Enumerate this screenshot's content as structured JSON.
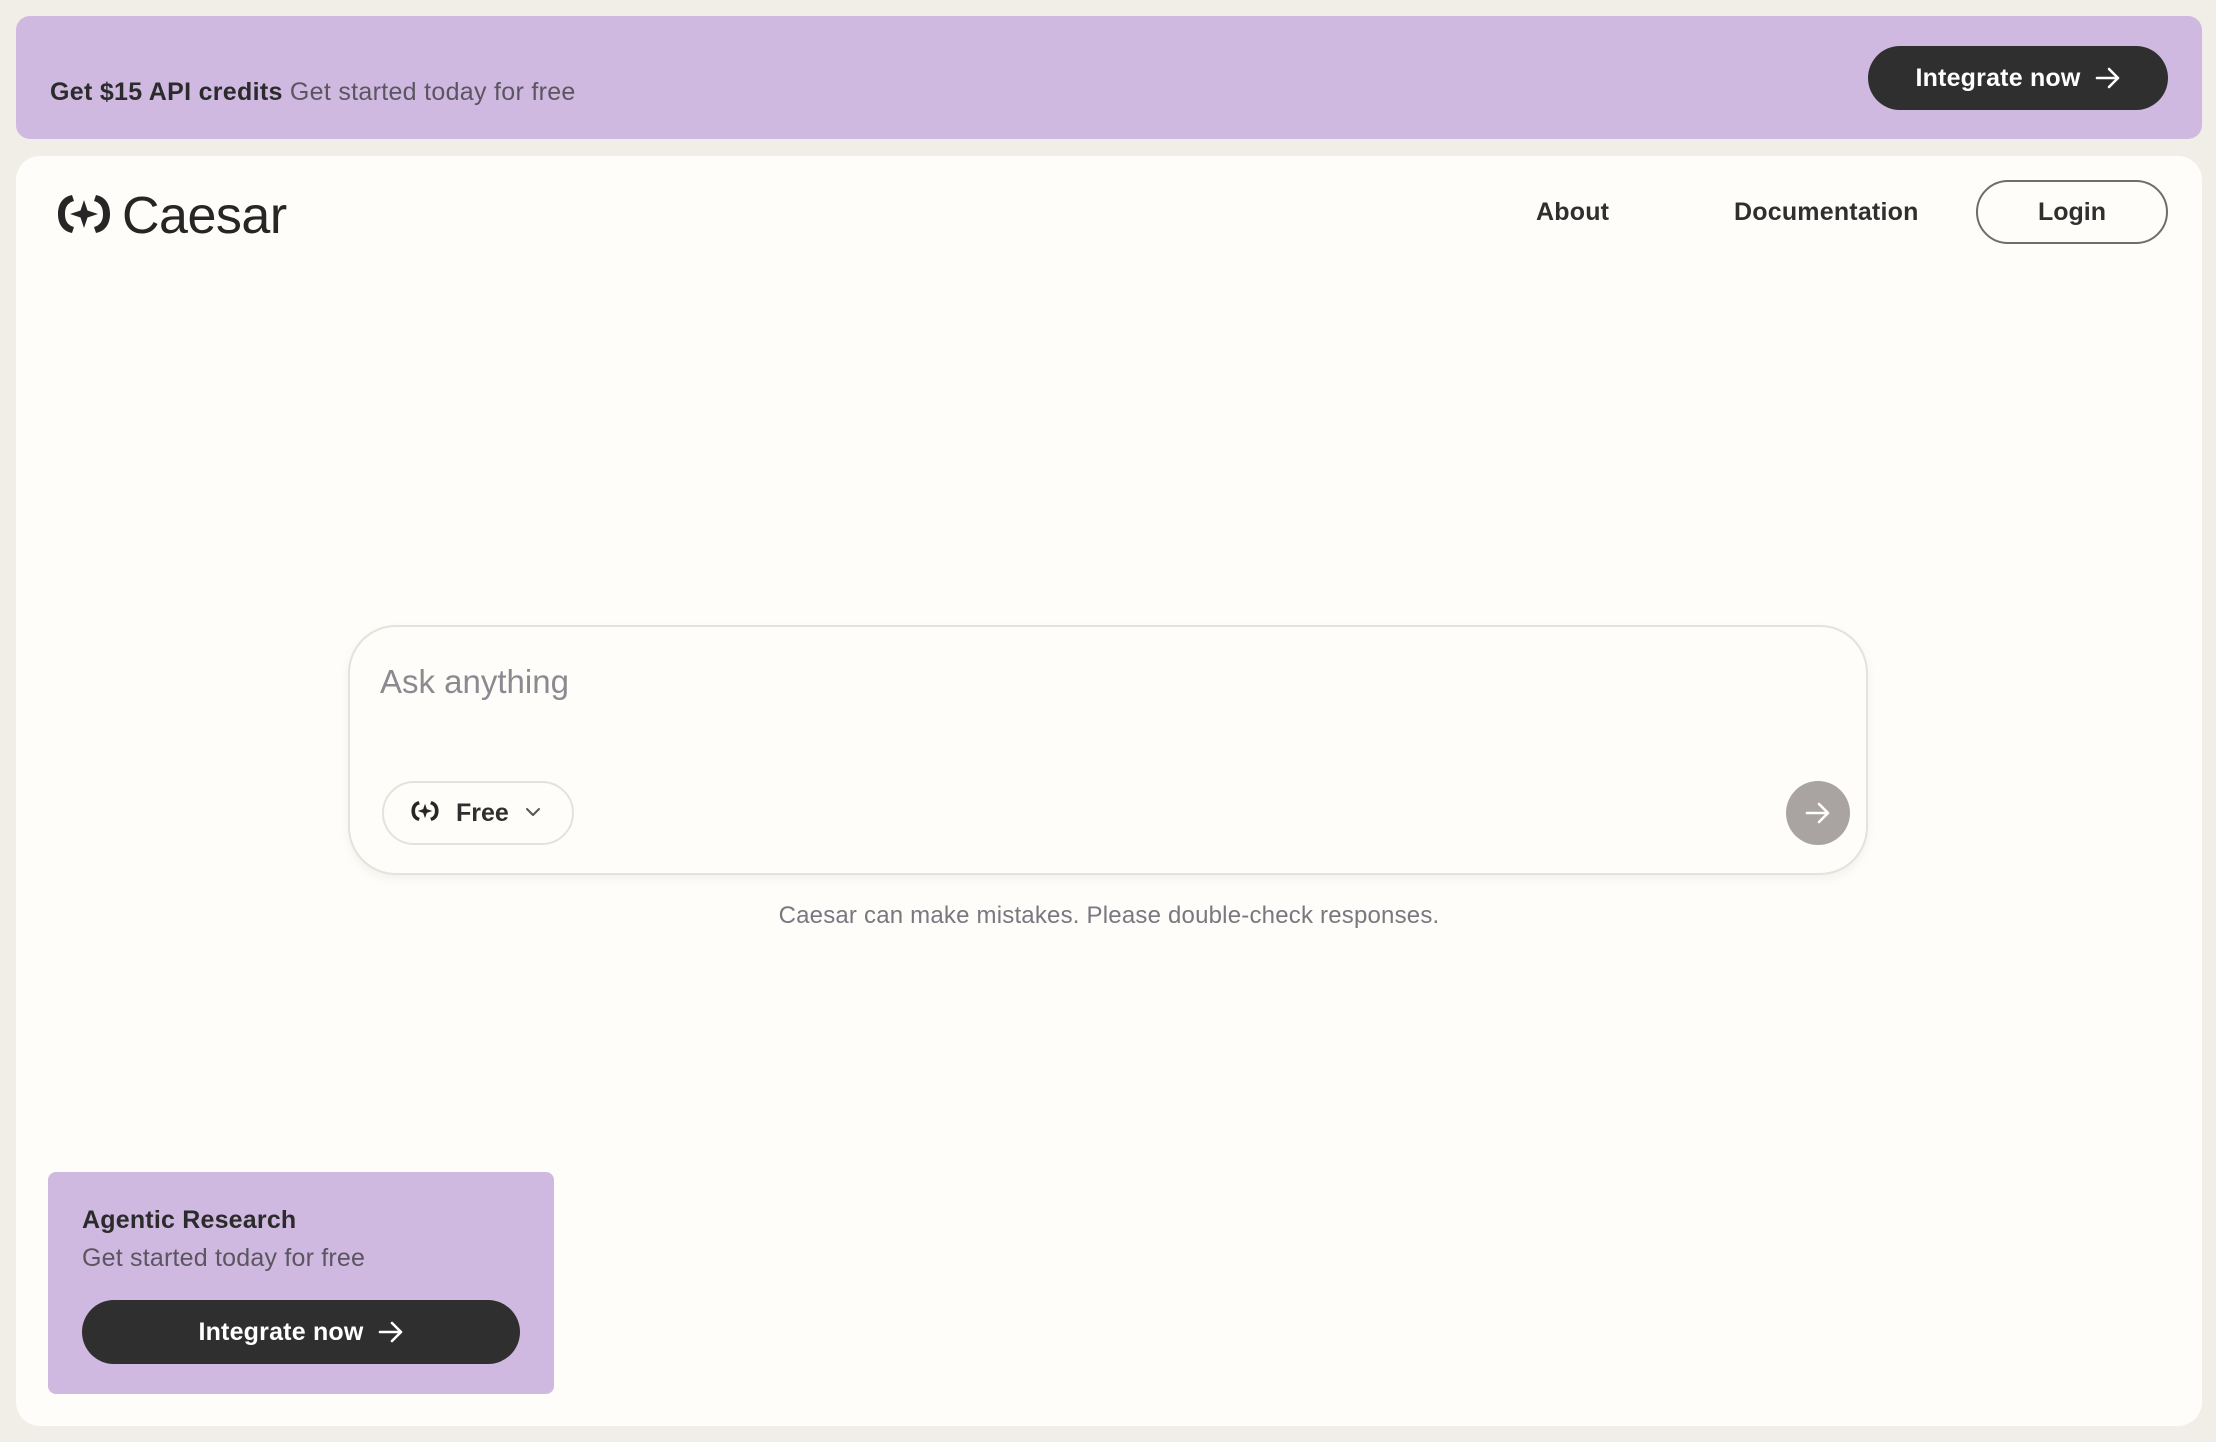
{
  "banner": {
    "strong": "Get $15 API credits",
    "sub": "Get started today for free",
    "button_label": "Integrate now"
  },
  "header": {
    "logo_text": "Caesar",
    "nav": [
      "About",
      "Documentation"
    ],
    "login_label": "Login"
  },
  "chat": {
    "placeholder": "Ask anything",
    "model_label": "Free",
    "disclaimer": "Caesar can make mistakes. Please double-check responses."
  },
  "promo": {
    "title": "Agentic Research",
    "sub": "Get started today for free",
    "button_label": "Integrate now"
  },
  "colors": {
    "accent": "#d0b9e1",
    "dark_button": "#2f2f2f",
    "page_bg": "#f1eee8",
    "card_bg": "#fefdf9",
    "send_button": "#a9a4a2"
  },
  "icons": {
    "logo": "caesar-logo-icon",
    "arrow": "arrow-right-icon",
    "chevron": "chevron-down-icon"
  }
}
